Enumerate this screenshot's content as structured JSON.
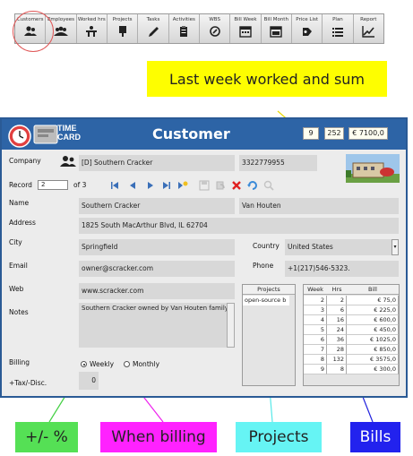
{
  "toolbar": {
    "items": [
      {
        "label": "Customers",
        "icon": "users-icon"
      },
      {
        "label": "Employees",
        "icon": "employees-icon"
      },
      {
        "label": "Worked hrs",
        "icon": "worked-hours-icon"
      },
      {
        "label": "Projects",
        "icon": "projects-icon"
      },
      {
        "label": "Tasks",
        "icon": "pencil-icon"
      },
      {
        "label": "Activities",
        "icon": "clipboard-icon"
      },
      {
        "label": "WBS",
        "icon": "wbs-icon"
      },
      {
        "label": "Bill Week",
        "icon": "calendar-icon"
      },
      {
        "label": "Bill Month",
        "icon": "calendar-month-icon"
      },
      {
        "label": "Price List",
        "icon": "price-list-icon"
      },
      {
        "label": "Plan",
        "icon": "list-icon"
      },
      {
        "label": "Report",
        "icon": "chart-icon"
      }
    ]
  },
  "callouts": {
    "last_week": "Last week worked and sum",
    "tax": "+/- %",
    "when_billing": "When billing",
    "projects": "Projects",
    "bills": "Bills"
  },
  "window": {
    "logo_line1": "TIME",
    "logo_line2": "CARD",
    "title": "Customer",
    "stats": {
      "week": "9",
      "hours": "252",
      "sum": "€ 7100,0"
    }
  },
  "form": {
    "company_label": "Company",
    "company_value": "[D] Southern Cracker",
    "phone_top": "3322779955",
    "record_label": "Record",
    "record_value": "2",
    "record_of": "of 3",
    "name_label": "Name",
    "first_name": "Southern Cracker",
    "last_name": "Van Houten",
    "address_label": "Address",
    "address_value": "1825 South MacArthur Blvd, IL 62704",
    "city_label": "City",
    "city_value": "Springfield",
    "country_label": "Country",
    "country_value": "United States",
    "email_label": "Email",
    "email_value": "owner@scracker.com",
    "phone_label": "Phone",
    "phone_value": "+1(217)546-5323.",
    "web_label": "Web",
    "web_value": "www.scracker.com",
    "notes_label": "Notes",
    "notes_value": "Southern Cracker owned by Van Houten family",
    "billing_label": "Billing",
    "billing_weekly": "Weekly",
    "billing_monthly": "Monthly",
    "tax_label": "+Tax/-Disc.",
    "tax_value": "0"
  },
  "projects": {
    "header": "Projects",
    "rows": [
      "open-source b"
    ]
  },
  "bills": {
    "headers": [
      "Week",
      "Hrs",
      "Bill"
    ],
    "rows": [
      [
        "2",
        "2",
        "€ 75,0"
      ],
      [
        "3",
        "6",
        "€ 225,0"
      ],
      [
        "4",
        "16",
        "€ 600,0"
      ],
      [
        "5",
        "24",
        "€ 450,0"
      ],
      [
        "6",
        "36",
        "€ 1025,0"
      ],
      [
        "7",
        "28",
        "€ 850,0"
      ],
      [
        "8",
        "132",
        "€ 3575,0"
      ],
      [
        "9",
        "8",
        "€ 300,0"
      ]
    ]
  }
}
